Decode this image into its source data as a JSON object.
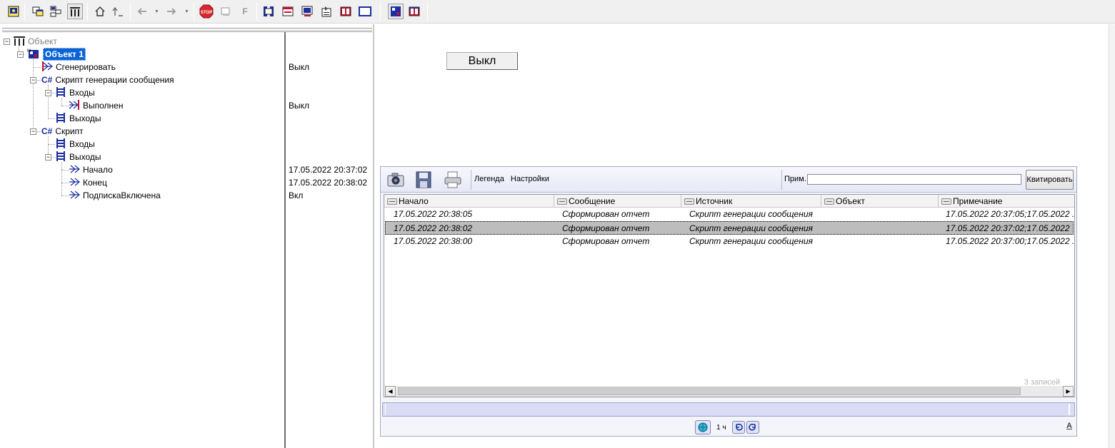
{
  "toolbar": {
    "buttons": [
      {
        "id": "console",
        "icon": "console-icon"
      },
      {
        "id": "windows",
        "icon": "windows-icon"
      },
      {
        "id": "network",
        "icon": "network-icon"
      },
      {
        "id": "tree",
        "icon": "tree-icon",
        "pressed": true
      },
      {
        "id": "home",
        "icon": "home-icon"
      },
      {
        "id": "up",
        "icon": "up-level-icon"
      },
      {
        "id": "back",
        "icon": "back-arrow-icon"
      },
      {
        "id": "forward",
        "icon": "forward-arrow-icon"
      },
      {
        "id": "stop",
        "icon": "stop-icon",
        "label": "STOP"
      },
      {
        "id": "script",
        "icon": "script-icon"
      },
      {
        "id": "function",
        "icon": "function-icon",
        "label": "F"
      },
      {
        "id": "columns",
        "icon": "columns-icon"
      },
      {
        "id": "form",
        "icon": "form-icon"
      },
      {
        "id": "monitor",
        "icon": "monitor-icon"
      },
      {
        "id": "properties",
        "icon": "properties-icon"
      },
      {
        "id": "book",
        "icon": "book-icon"
      },
      {
        "id": "window",
        "icon": "window-icon"
      },
      {
        "id": "layout1",
        "icon": "layout-icon"
      },
      {
        "id": "layout2",
        "icon": "book-layout-icon"
      }
    ]
  },
  "tree": {
    "root": "Объект",
    "object": "Объект 1",
    "generate": "Сгенерировать",
    "script_gen": "Скрипт генерации сообщения",
    "inputs": "Входы",
    "done": "Выполнен",
    "outputs": "Выходы",
    "script": "Скрипт",
    "inputs2": "Входы",
    "outputs2": "Выходы",
    "start": "Начало",
    "end": "Конец",
    "subscription": "ПодпискаВключена",
    "cs_label": "C#"
  },
  "values": {
    "generate": "Выкл",
    "done": "Выкл",
    "start": "17.05.2022 20:37:02",
    "end": "17.05.2022 20:38:02",
    "subscription": "Вкл"
  },
  "off_button": "Выкл",
  "journal": {
    "menu": [
      "Легенда",
      "Настройки"
    ],
    "note_label": "Прим.",
    "note_value": "",
    "ack_button": "Квитировать",
    "columns": [
      "Начало",
      "Сообщение",
      "Источник",
      "Объект",
      "Примечание"
    ],
    "rows": [
      {
        "start": "17.05.2022 20:38:05",
        "message": "Сформирован отчет",
        "source": "Скрипт генерации сообщения",
        "object": "",
        "note": "17.05.2022 20:37:05;17.05.2022 ."
      },
      {
        "start": "17.05.2022 20:38:02",
        "message": "Сформирован отчет",
        "source": "Скрипт генерации сообщения",
        "object": "",
        "note": "17.05.2022 20:37:02;17.05.2022",
        "selected": true
      },
      {
        "start": "17.05.2022 20:38:00",
        "message": "Сформирован отчет",
        "source": "Скрипт генерации сообщения",
        "object": "",
        "note": "17.05.2022 20:37:00;17.05.2022 ."
      }
    ],
    "records": "3  записей",
    "period": "1 ч",
    "a_label": "A"
  },
  "colors": {
    "selection": "#0a64d6",
    "cs_blue": "#1a2fa0",
    "selected_row": "#bdbdbd",
    "timeline": "#dadcf5"
  }
}
